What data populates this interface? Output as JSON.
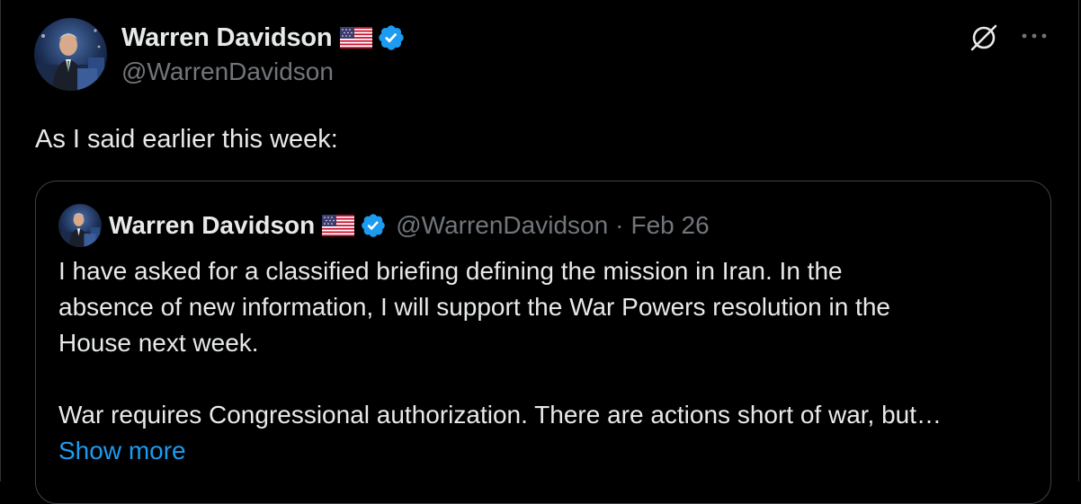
{
  "tweet": {
    "author": {
      "display_name": "Warren Davidson",
      "handle": "@WarrenDavidson",
      "flag_icon": "us-flag-icon",
      "verified_icon": "verified-badge-icon"
    },
    "text": "As I said earlier this week:",
    "actions": {
      "grok_icon": "grok-icon",
      "more_icon": "more-options-icon"
    }
  },
  "quoted_tweet": {
    "author": {
      "display_name": "Warren Davidson",
      "handle": "@WarrenDavidson"
    },
    "separator": "·",
    "date": "Feb 26",
    "lines": [
      "I have asked for a classified briefing defining the mission in Iran. In the",
      "absence of new information, I will support the War Powers resolution in the",
      "House next week.",
      "",
      "War requires Congressional authorization. There are actions short of war, but…"
    ],
    "show_more": "Show more"
  },
  "colors": {
    "background": "#000000",
    "text": "#e7e9ea",
    "secondary": "#71767b",
    "accent": "#1d9bf0",
    "border": "#3e4144"
  }
}
